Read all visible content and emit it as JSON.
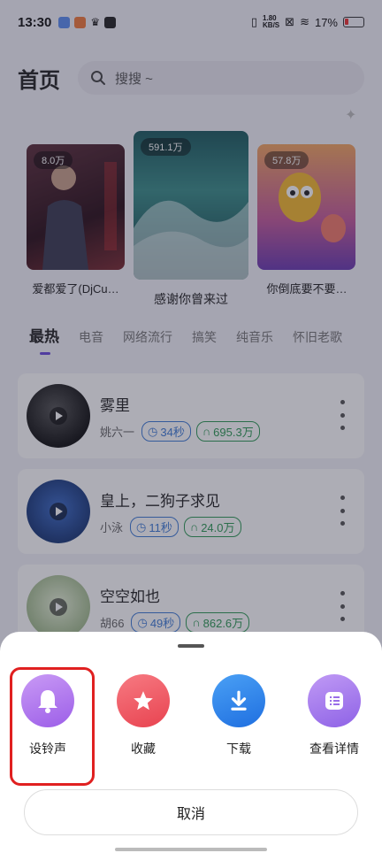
{
  "status_bar": {
    "time": "13:30",
    "net_speed": "1.80\nKB/S",
    "battery": "17%"
  },
  "header": {
    "title": "首页",
    "search_placeholder": "搜搜 ~"
  },
  "banners": [
    {
      "plays": "8.0万",
      "title": "爱都爱了(DjCu…"
    },
    {
      "plays": "591.1万",
      "title": "感谢你曾来过"
    },
    {
      "plays": "57.8万",
      "title": "你倒底要不要…"
    }
  ],
  "tabs": [
    "最热",
    "电音",
    "网络流行",
    "搞笑",
    "纯音乐",
    "怀旧老歌"
  ],
  "songs": [
    {
      "title": "雾里",
      "artist": "姚六一",
      "duration": "34秒",
      "plays": "695.3万"
    },
    {
      "title": "皇上，二狗子求见",
      "artist": "小泳",
      "duration": "11秒",
      "plays": "24.0万"
    },
    {
      "title": "空空如也",
      "artist": "胡66",
      "duration": "49秒",
      "plays": "862.6万"
    }
  ],
  "sheet": {
    "actions": [
      {
        "label": "设铃声",
        "icon": "bell-icon",
        "color": "#b57bef"
      },
      {
        "label": "收藏",
        "icon": "star-icon",
        "color": "#ef5a66"
      },
      {
        "label": "下载",
        "icon": "download-icon",
        "color": "#2f86f0"
      },
      {
        "label": "查看详情",
        "icon": "details-icon",
        "color": "#a57cf0"
      }
    ],
    "cancel": "取消"
  },
  "colors": {
    "accent": "#6b4bdc",
    "highlight": "#e02020"
  }
}
